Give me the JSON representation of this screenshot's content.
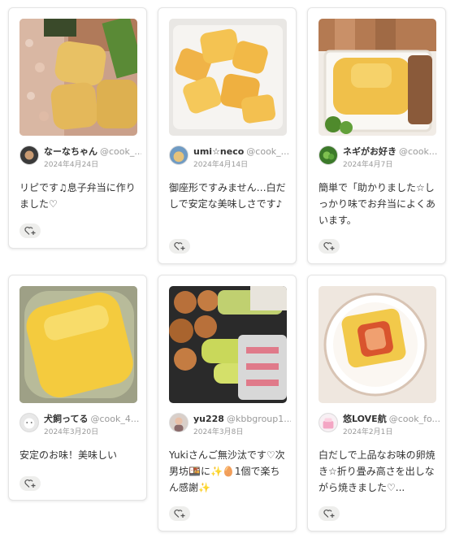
{
  "cards": [
    {
      "user_name": "なーなちゃん",
      "user_id": "@cook_...",
      "date": "2024年4月24日",
      "comment": "リピです♫息子弁当に作りました♡"
    },
    {
      "user_name": "umi☆neco",
      "user_id": "@cook_...",
      "date": "2024年4月14日",
      "comment": "御座形ですみません…白だしで安定な美味しさです♪"
    },
    {
      "user_name": "ネギがお好き",
      "user_id": "@cook...",
      "date": "2024年4月7日",
      "comment": "簡単で「助かりました☆しっかり味でお弁当によくあいます。"
    },
    {
      "user_name": "犬飼ってる",
      "user_id": "@cook_4...",
      "date": "2024年3月20日",
      "comment": "安定のお味！美味しい"
    },
    {
      "user_name": "yu228",
      "user_id": "@kbbgroup1...",
      "date": "2024年3月8日",
      "comment": "Yukiさんご無沙汰です♡次男坊🍱に✨🥚1個で楽ちん感謝✨"
    },
    {
      "user_name": "悠LOVE航",
      "user_id": "@cook_fo...",
      "date": "2024年2月1日",
      "comment": "白だしで上品なお味の卵焼き☆折り畳み高さを出しながら焼きました♡..."
    }
  ],
  "icons": {
    "like": "heart-plus-icon"
  },
  "colors": {
    "egg": "#f2c14a",
    "like_bg": "#eeeeec"
  }
}
